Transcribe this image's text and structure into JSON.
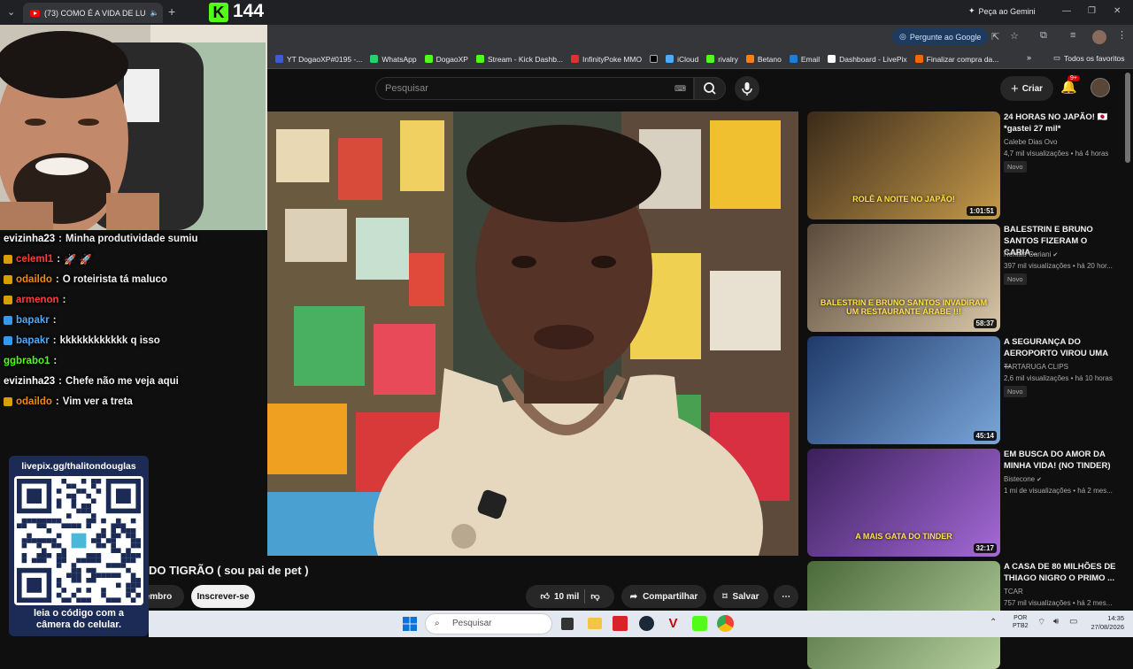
{
  "browser": {
    "tab_title": "(73) COMO É A VIDA DE LU",
    "gemini_label": "Peça ao Gemini",
    "ask_google_label": "Pergunte ao Google",
    "all_favorites": "Todos os favoritos",
    "bookmarks": [
      {
        "label": "YT DogaoXP#0195 -...",
        "color": "#3b5bdb"
      },
      {
        "label": "WhatsApp",
        "color": "#25d366"
      },
      {
        "label": "DogaoXP",
        "color": "#53fc18"
      },
      {
        "label": "Stream - Kick Dashb...",
        "color": "#53fc18"
      },
      {
        "label": "InfinityPoke MMO",
        "color": "#e03131"
      },
      {
        "label": "",
        "color": "#000000"
      },
      {
        "label": "iCloud",
        "color": "#4dabf7"
      },
      {
        "label": "rivalry",
        "color": "#53fc18"
      },
      {
        "label": "Betano",
        "color": "#fd7e14"
      },
      {
        "label": "Email",
        "color": "#1c7ed6"
      },
      {
        "label": "Dashboard - LivePix",
        "color": "#ffffff"
      },
      {
        "label": "Finalizar compra da...",
        "color": "#f76707"
      }
    ]
  },
  "kick": {
    "viewer_count": "144"
  },
  "youtube": {
    "search_placeholder": "Pesquisar",
    "create_label": "Criar",
    "notif_count": "9+",
    "video_title_partial": "DO TIGRÃO ( sou pai de pet )",
    "member_label": "embro",
    "subscribe_label": "Inscrever-se",
    "likes": "10 mil",
    "share_label": "Compartilhar",
    "save_label": "Salvar"
  },
  "chat": [
    {
      "user": "evizinha23",
      "text": "Minha produtividade sumiu",
      "user_color": "#ffffff",
      "badge": ""
    },
    {
      "user": "celeml1",
      "text": "🚀 🚀",
      "user_color": "#ff3b3b",
      "badge": "#d6a000"
    },
    {
      "user": "odaildo",
      "text": "O roteirista tá maluco",
      "user_color": "#f08c00",
      "badge": "#d6a000"
    },
    {
      "user": "armenon",
      "text": "",
      "user_color": "#ff3b3b",
      "badge": "#d6a000"
    },
    {
      "user": "bapakr",
      "text": "",
      "user_color": "#4dabf7",
      "badge": "#339af0"
    },
    {
      "user": "bapakr",
      "text": "kkkkkkkkkkkk q isso",
      "user_color": "#4dabf7",
      "badge": "#339af0"
    },
    {
      "user": "ggbrabo1",
      "text": "",
      "user_color": "#53fc18",
      "badge": ""
    },
    {
      "user": "evizinha23",
      "text": "Chefe não me veja aqui",
      "user_color": "#ffffff",
      "badge": ""
    },
    {
      "user": "odaildo",
      "text": "Vim ver a treta",
      "user_color": "#f08c00",
      "badge": "#d6a000"
    }
  ],
  "livepix": {
    "url": "livepix.gg/thalitondouglas",
    "caption_line1": "leia o código com a",
    "caption_line2": "câmera do celular."
  },
  "recommendations": [
    {
      "title": "24 HORAS NO JAPÃO! 🇯🇵 *gastei 27 mil*",
      "channel": "Calebe Dias Ovo",
      "meta": "4,7 mil visualizações • há 4 horas",
      "badge": "Novo",
      "duration": "1:01:51",
      "verified": false,
      "thumb_text": "ROLÊ A NOITE NO JAPÃO!",
      "thumb_colors": [
        "#3a2a1a",
        "#c59a4a"
      ]
    },
    {
      "title": "BALESTRIN E BRUNO SANTOS FIZERAM O CARIA...",
      "channel": "Renato Cariani",
      "meta": "397 mil visualizações • há 20 hor...",
      "badge": "Novo",
      "duration": "58:37",
      "verified": true,
      "thumb_text": "BALESTRIN E BRUNO SANTOS INVADIRAM UM RESTAURANTE ÁRABE !!!",
      "thumb_colors": [
        "#5a4a3a",
        "#d9c7a8"
      ]
    },
    {
      "title": "A SEGURANÇA DO AEROPORTO VIROU UMA ...",
      "channel": "TARTARUGA CLIPS",
      "meta": "2,6 mil visualizações • há 10 horas",
      "badge": "Novo",
      "duration": "45:14",
      "verified": false,
      "thumb_text": "",
      "thumb_colors": [
        "#1e3a6a",
        "#7aa6d8"
      ]
    },
    {
      "title": "EM BUSCA DO AMOR DA MINHA VIDA! (NO TINDER)",
      "channel": "Bistecone",
      "meta": "1 mi de visualizações • há 2 mes...",
      "badge": "",
      "duration": "32:17",
      "verified": true,
      "thumb_text": "A MAIS GATA DO TINDER",
      "thumb_colors": [
        "#3a1f5a",
        "#a56ad8"
      ]
    },
    {
      "title": "A CASA DE 80 MILHÕES DE THIAGO NIGRO O PRIMO ...",
      "channel": "TCAR",
      "meta": "757 mil visualizações • há 2 mes...",
      "badge": "",
      "duration": "",
      "verified": false,
      "thumb_text": "",
      "thumb_colors": [
        "#4a6a3a",
        "#b8d0a0"
      ]
    }
  ],
  "taskbar": {
    "search_placeholder": "Pesquisar",
    "lang_line1": "POR",
    "lang_line2": "PTB2",
    "time": "14:35",
    "date": "27/08/2026"
  }
}
